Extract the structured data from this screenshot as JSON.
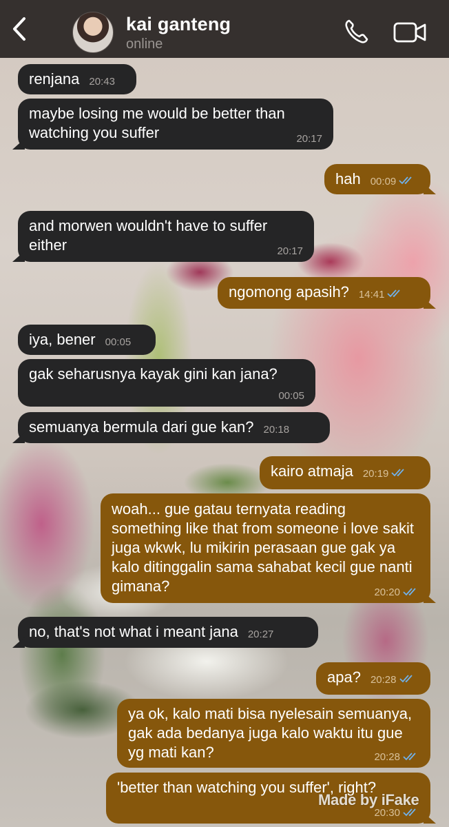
{
  "header": {
    "contact_name": "kai ganteng",
    "status": "online",
    "icons": [
      "back-arrow-icon",
      "phone-icon",
      "video-camera-icon"
    ]
  },
  "colors": {
    "header_bg": "#35302e",
    "incoming_bubble": "#252526",
    "outgoing_bubble": "#86570c",
    "read_ticks": "#6fb2ee"
  },
  "messages": [
    {
      "from": "them",
      "text": "renjana",
      "time": "20:43"
    },
    {
      "from": "them",
      "text": "maybe losing me would be better than watching you suffer",
      "time": "20:17"
    },
    {
      "from": "me",
      "text": "hah",
      "time": "00:09",
      "read": true
    },
    {
      "from": "them",
      "text": "and morwen wouldn't have to suffer either",
      "time": "20:17"
    },
    {
      "from": "me",
      "text": "ngomong apasih?",
      "time": "14:41",
      "read": true
    },
    {
      "from": "them",
      "text": "iya, bener",
      "time": "00:05"
    },
    {
      "from": "them",
      "text": "gak seharusnya kayak gini kan jana?",
      "time": "00:05"
    },
    {
      "from": "them",
      "text": "semuanya bermula dari gue kan?",
      "time": "20:18"
    },
    {
      "from": "me",
      "text": "kairo atmaja",
      "time": "20:19",
      "read": true
    },
    {
      "from": "me",
      "text": "woah... gue gatau ternyata reading something like that from someone i love sakit juga wkwk, lu mikirin perasaan gue gak ya kalo ditinggalin sama sahabat kecil gue nanti gimana?",
      "time": "20:20",
      "read": true
    },
    {
      "from": "them",
      "text": "no, that's not what i meant jana",
      "time": "20:27"
    },
    {
      "from": "me",
      "text": "apa?",
      "time": "20:28",
      "read": true
    },
    {
      "from": "me",
      "text": "ya ok, kalo mati bisa nyelesain semuanya, gak ada bedanya juga kalo waktu itu gue yg mati kan?",
      "time": "20:28",
      "read": true
    },
    {
      "from": "me",
      "text": "'better than watching you suffer', right?",
      "time": "20:30",
      "read": true
    }
  ],
  "watermark": "Made by iFake"
}
